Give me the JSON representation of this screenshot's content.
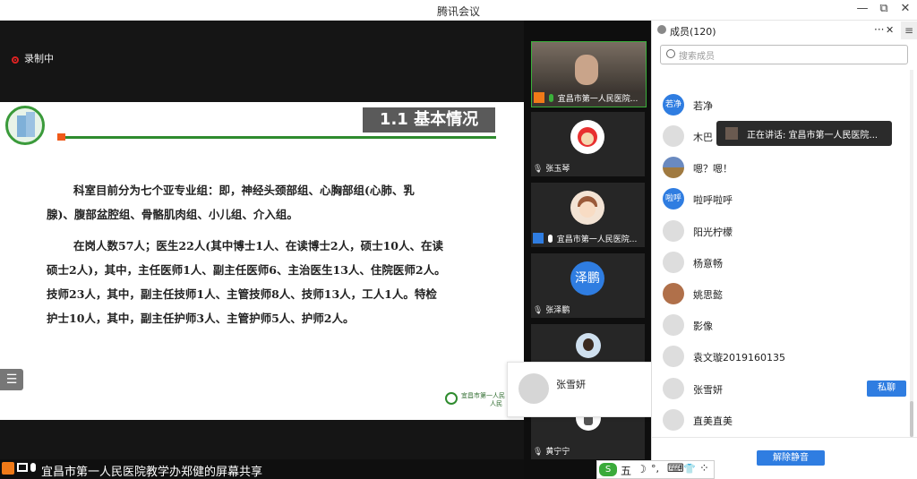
{
  "window": {
    "title": "腾讯会议",
    "minimize": "—",
    "restore": "⧉",
    "close": "✕"
  },
  "stage": {
    "recording_label": "录制中",
    "slide": {
      "heading": "1.1 基本情况",
      "paragraphs": [
        "科室目前分为七个亚专业组：即，神经头颈部组、心胸部组(心肺、乳",
        "腺)、腹部盆腔组、骨骼肌肉组、小儿组、介入组。",
        "在岗人数57人；医生22人(其中博士1人、在读博士2人，硕士10人、在读",
        "硕士2人)，其中，主任医师1人、副主任医师6、主治医生13人、住院医师2人。",
        "技师23人，其中，副主任技师1人、主管技师8人、技师13人，工人1人。特检",
        "护士10人，其中，副主任护师3人、主管护师5人、护师2人。"
      ],
      "footer_logo_line1": "宜昌市第一人民",
      "footer_logo_line2": "人民"
    },
    "share_text": "宜昌市第一人民医院教学办郑健的屏幕共享"
  },
  "gallery": {
    "tiles": [
      {
        "name": "宜昌市第一人民医院...",
        "avatar_text": ""
      },
      {
        "name": "张玉琴",
        "avatar_text": ""
      },
      {
        "name": "宜昌市第一人民医院...",
        "avatar_text": ""
      },
      {
        "name": "张泽鹏",
        "avatar_text": "泽鹏"
      },
      {
        "name": "",
        "avatar_text": ""
      },
      {
        "name": "黄宁宁",
        "avatar_text": ""
      }
    ],
    "hover_card_name": "张雪妍"
  },
  "members_panel": {
    "title": "成员(120)",
    "more": "···",
    "close": "✕",
    "menu": "≡",
    "search_placeholder": "搜索成员",
    "speaking_tooltip": "正在讲话: 宜昌市第一人民医院...",
    "private_chat_label": "私聊",
    "unmute_label": "解除静音",
    "members": [
      {
        "name": "若净",
        "avatar_text": "若净",
        "avatar_color": "#2f7de1"
      },
      {
        "name": "木巴",
        "avatar_text": "",
        "avatar_color": "#d9d9d9"
      },
      {
        "name": "嗯？嗯！",
        "avatar_text": "",
        "avatar_color": "#8a6a3a"
      },
      {
        "name": "啦呼啦呼",
        "avatar_text": "啦呼",
        "avatar_color": "#2f7de1"
      },
      {
        "name": "阳光柠檬",
        "avatar_text": "",
        "avatar_color": "#d9d9d9"
      },
      {
        "name": "杨意畅",
        "avatar_text": "",
        "avatar_color": "#d9d9d9"
      },
      {
        "name": "姚思懿",
        "avatar_text": "",
        "avatar_color": "#b0704a"
      },
      {
        "name": "影像",
        "avatar_text": "",
        "avatar_color": "#d9d9d9"
      },
      {
        "name": "袁文璇2019160135",
        "avatar_text": "",
        "avatar_color": "#d9d9d9"
      },
      {
        "name": "张雪妍",
        "avatar_text": "",
        "avatar_color": "#d9d9d9"
      },
      {
        "name": "直美直美",
        "avatar_text": "",
        "avatar_color": "#d9d9d9"
      }
    ]
  },
  "ime_toolbar": {
    "items": [
      "五",
      "☽",
      "°,",
      "⌨",
      "👕",
      "⁘"
    ]
  }
}
